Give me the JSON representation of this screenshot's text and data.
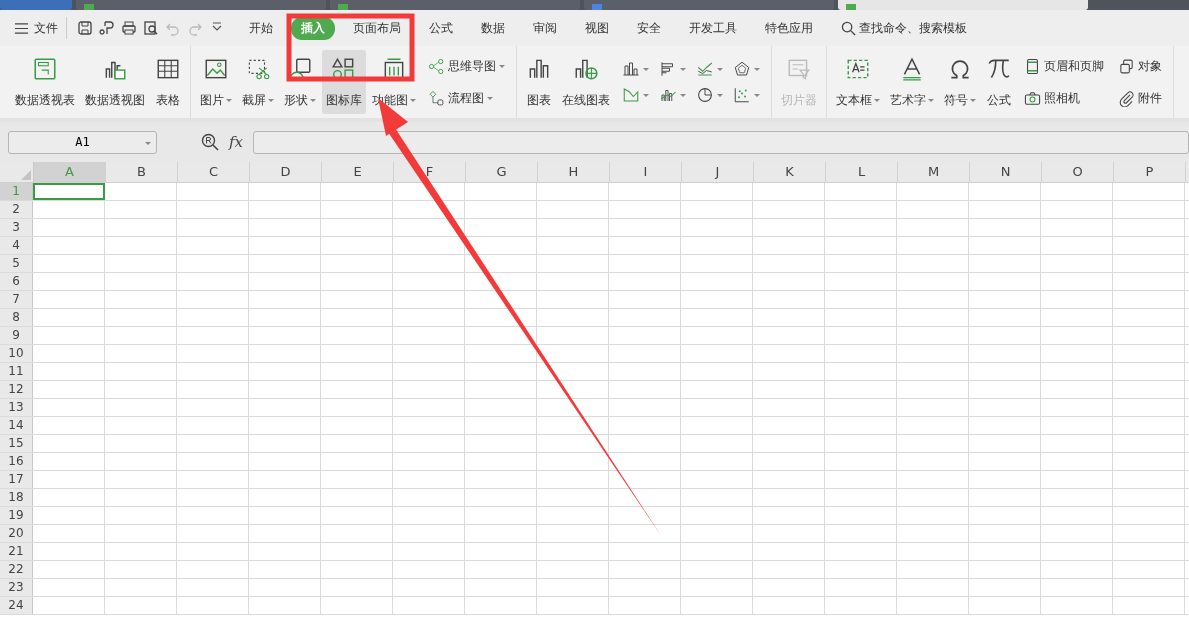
{
  "document_tabs": [
    {
      "kind": "app",
      "selected": false
    },
    {
      "kind": "sheet",
      "selected": false
    },
    {
      "kind": "sheet",
      "selected": false
    },
    {
      "kind": "doc",
      "selected": false
    },
    {
      "kind": "sheet",
      "selected": true
    }
  ],
  "menu": {
    "file": "文件",
    "tabs": [
      {
        "label": "开始",
        "selected": false
      },
      {
        "label": "插入",
        "selected": true
      },
      {
        "label": "页面布局",
        "selected": false
      },
      {
        "label": "公式",
        "selected": false
      },
      {
        "label": "数据",
        "selected": false
      },
      {
        "label": "审阅",
        "selected": false
      },
      {
        "label": "视图",
        "selected": false
      },
      {
        "label": "安全",
        "selected": false
      },
      {
        "label": "开发工具",
        "selected": false
      },
      {
        "label": "特色应用",
        "selected": false
      }
    ],
    "search": "查找命令、搜索模板"
  },
  "ribbon": {
    "groups": [
      {
        "items": [
          {
            "kind": "large",
            "label": "数据透视表",
            "dropdown": false,
            "highlighted": false,
            "disabled": false
          },
          {
            "kind": "large",
            "label": "数据透视图",
            "dropdown": false,
            "highlighted": false,
            "disabled": false
          },
          {
            "kind": "large",
            "label": "表格",
            "dropdown": false,
            "highlighted": false,
            "disabled": false
          }
        ]
      },
      {
        "items": [
          {
            "kind": "large",
            "label": "图片",
            "dropdown": true,
            "highlighted": false,
            "disabled": false
          },
          {
            "kind": "large",
            "label": "截屏",
            "dropdown": true,
            "highlighted": false,
            "disabled": false
          },
          {
            "kind": "large",
            "label": "形状",
            "dropdown": true,
            "highlighted": false,
            "disabled": false
          },
          {
            "kind": "large",
            "label": "图标库",
            "dropdown": false,
            "highlighted": true,
            "disabled": false
          },
          {
            "kind": "large",
            "label": "功能图",
            "dropdown": true,
            "highlighted": false,
            "disabled": false
          },
          {
            "kind": "stack",
            "entries": [
              {
                "label": "思维导图",
                "dropdown": true
              },
              {
                "label": "流程图",
                "dropdown": true
              }
            ]
          }
        ]
      },
      {
        "items": [
          {
            "kind": "large",
            "label": "图表",
            "dropdown": false,
            "highlighted": false,
            "disabled": false
          },
          {
            "kind": "large",
            "label": "在线图表",
            "dropdown": false,
            "highlighted": false,
            "disabled": false
          },
          {
            "kind": "chart_grid",
            "buttons": [
              {
                "dropdown": true
              },
              {
                "dropdown": true
              },
              {
                "dropdown": true
              },
              {
                "dropdown": true
              },
              {
                "dropdown": true
              },
              {
                "dropdown": true
              },
              {
                "dropdown": true
              },
              {
                "dropdown": true
              }
            ]
          }
        ]
      },
      {
        "items": [
          {
            "kind": "large",
            "label": "切片器",
            "dropdown": false,
            "highlighted": false,
            "disabled": true
          }
        ]
      },
      {
        "items": [
          {
            "kind": "large",
            "label": "文本框",
            "dropdown": true,
            "highlighted": false,
            "disabled": false
          },
          {
            "kind": "large",
            "label": "艺术字",
            "dropdown": true,
            "highlighted": false,
            "disabled": false
          },
          {
            "kind": "large",
            "label": "符号",
            "dropdown": true,
            "highlighted": false,
            "disabled": false
          },
          {
            "kind": "large",
            "label": "公式",
            "dropdown": false,
            "highlighted": false,
            "disabled": false
          },
          {
            "kind": "stack",
            "entries": [
              {
                "label": "页眉和页脚",
                "dropdown": false
              },
              {
                "label": "照相机",
                "dropdown": false
              }
            ]
          },
          {
            "kind": "stack",
            "entries": [
              {
                "label": "对象",
                "dropdown": false
              },
              {
                "label": "附件",
                "dropdown": false
              }
            ]
          }
        ]
      }
    ]
  },
  "formula_bar": {
    "name_box": "A1",
    "fx": "fx"
  },
  "sheet": {
    "columns": [
      {
        "label": "A",
        "selected": true
      },
      {
        "label": "B",
        "selected": false
      },
      {
        "label": "C",
        "selected": false
      },
      {
        "label": "D",
        "selected": false
      },
      {
        "label": "E",
        "selected": false
      },
      {
        "label": "F",
        "selected": false
      },
      {
        "label": "G",
        "selected": false
      },
      {
        "label": "H",
        "selected": false
      },
      {
        "label": "I",
        "selected": false
      },
      {
        "label": "J",
        "selected": false
      },
      {
        "label": "K",
        "selected": false
      },
      {
        "label": "L",
        "selected": false
      },
      {
        "label": "M",
        "selected": false
      },
      {
        "label": "N",
        "selected": false
      },
      {
        "label": "O",
        "selected": false
      },
      {
        "label": "P",
        "selected": false
      }
    ],
    "rows": [
      {
        "label": "1",
        "selected": true
      },
      {
        "label": "2",
        "selected": false
      },
      {
        "label": "3",
        "selected": false
      },
      {
        "label": "4",
        "selected": false
      },
      {
        "label": "5",
        "selected": false
      },
      {
        "label": "6",
        "selected": false
      },
      {
        "label": "7",
        "selected": false
      },
      {
        "label": "8",
        "selected": false
      },
      {
        "label": "9",
        "selected": false
      },
      {
        "label": "10",
        "selected": false
      },
      {
        "label": "11",
        "selected": false
      },
      {
        "label": "12",
        "selected": false
      },
      {
        "label": "13",
        "selected": false
      },
      {
        "label": "14",
        "selected": false
      },
      {
        "label": "15",
        "selected": false
      },
      {
        "label": "16",
        "selected": false
      },
      {
        "label": "17",
        "selected": false
      },
      {
        "label": "18",
        "selected": false
      },
      {
        "label": "19",
        "selected": false
      },
      {
        "label": "20",
        "selected": false
      },
      {
        "label": "21",
        "selected": false
      },
      {
        "label": "22",
        "selected": false
      },
      {
        "label": "23",
        "selected": false
      },
      {
        "label": "24",
        "selected": false
      }
    ]
  },
  "annotation": {
    "highlight_box": true,
    "arrow": true
  }
}
